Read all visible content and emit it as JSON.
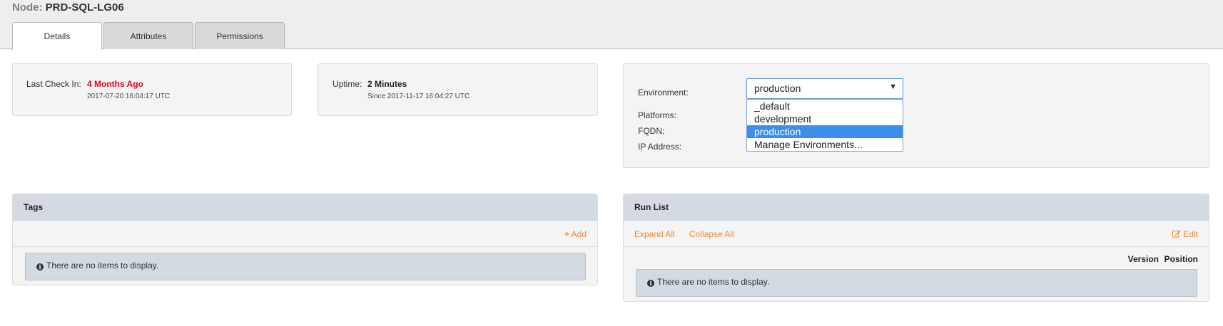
{
  "header": {
    "node_prefix": "Node:",
    "node_name": "PRD-SQL-LG06"
  },
  "tabs": [
    {
      "label": "Details",
      "active": true
    },
    {
      "label": "Attributes",
      "active": false
    },
    {
      "label": "Permissions",
      "active": false
    }
  ],
  "checkin": {
    "label": "Last Check In:",
    "value": "4 Months Ago",
    "timestamp": "2017-07-20 16:04:17 UTC",
    "value_color": "#e0001a"
  },
  "uptime": {
    "label": "Uptime:",
    "value": "2 Minutes",
    "since": "Since 2017-11-17 16:04:27 UTC"
  },
  "info": {
    "environment_label": "Environment:",
    "environment_value": "production",
    "environment_options": [
      "_default",
      "development",
      "production",
      "Manage Environments..."
    ],
    "platforms_label": "Platforms:",
    "fqdn_label": "FQDN:",
    "ip_label": "IP Address:"
  },
  "tags": {
    "title": "Tags",
    "add_label": "Add",
    "empty_text": "There are no items to display."
  },
  "runlist": {
    "title": "Run List",
    "expand_label": "Expand All",
    "collapse_label": "Collapse All",
    "edit_label": "Edit",
    "col_version": "Version",
    "col_position": "Position",
    "empty_text": "There are no items to display."
  },
  "colors": {
    "accent_orange": "#e88a3b",
    "select_highlight": "#3b8eea",
    "panel_header": "#d3dae1"
  }
}
